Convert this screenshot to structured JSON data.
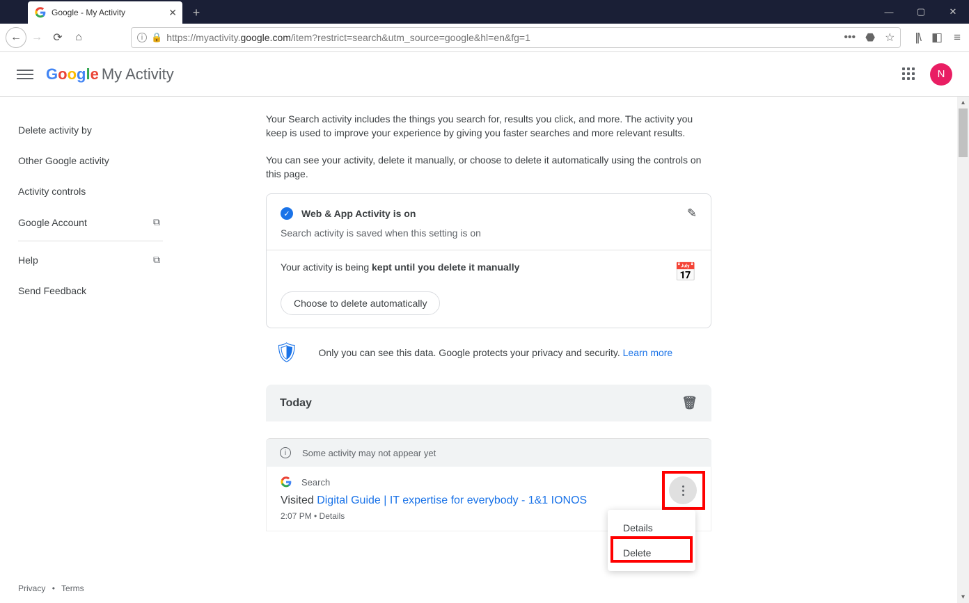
{
  "browser": {
    "tab_title": "Google - My Activity",
    "url_prefix": "https://myactivity.",
    "url_domain": "google.com",
    "url_path": "/item?restrict=search&utm_source=google&hl=en&fg=1"
  },
  "header": {
    "logo_text": "Google",
    "title": "My Activity",
    "avatar_letter": "N"
  },
  "sidebar": {
    "items": [
      {
        "label": "Delete activity by",
        "ext": false
      },
      {
        "label": "Other Google activity",
        "ext": false
      },
      {
        "label": "Activity controls",
        "ext": false
      },
      {
        "label": "Google Account",
        "ext": true
      }
    ],
    "help_items": [
      {
        "label": "Help",
        "ext": true
      },
      {
        "label": "Send Feedback",
        "ext": false
      }
    ]
  },
  "main": {
    "intro1": "Your Search activity includes the things you search for, results you click, and more. The activity you keep is used to improve your experience by giving you faster searches and more relevant results.",
    "intro2": "You can see your activity, delete it manually, or choose to delete it automatically using the controls on this page.",
    "waa_title": "Web & App Activity is on",
    "waa_sub": "Search activity is saved when this setting is on",
    "retention_prefix": "Your activity is being ",
    "retention_bold": "kept until you delete it manually",
    "auto_delete_btn": "Choose to delete automatically",
    "privacy_text": "Only you can see this data. Google protects your privacy and security. ",
    "privacy_link": "Learn more",
    "today": "Today",
    "pending": "Some activity may not appear yet",
    "service": "Search",
    "visited_prefix": "Visited ",
    "visited_link": "Digital Guide | IT expertise for everybody - 1&1 IONOS",
    "act_time": "2:07 PM • Details",
    "menu_details": "Details",
    "menu_delete": "Delete"
  },
  "footer": {
    "privacy": "Privacy",
    "terms": "Terms"
  }
}
